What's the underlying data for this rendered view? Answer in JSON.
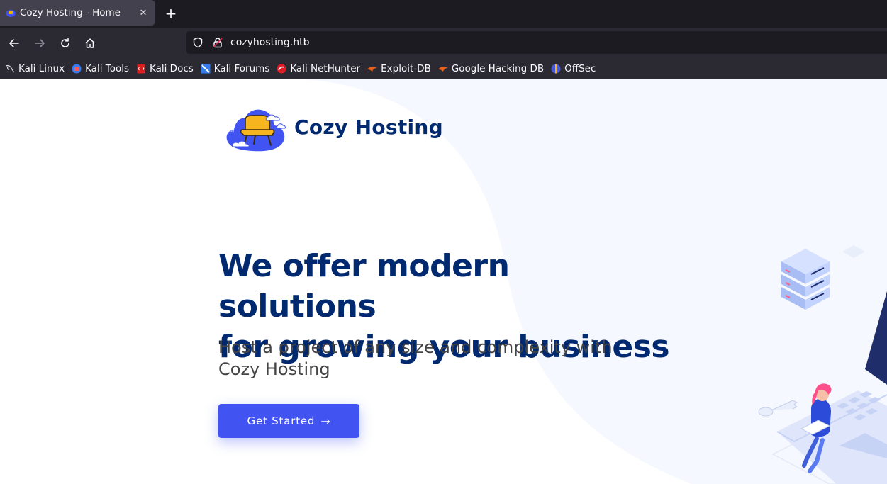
{
  "browser": {
    "tab": {
      "title": "Cozy Hosting - Home"
    },
    "url": "cozyhosting.htb",
    "bookmarks": [
      {
        "label": "Kali Linux",
        "icon": "kali-dragon-icon"
      },
      {
        "label": "Kali Tools",
        "icon": "kali-tools-icon"
      },
      {
        "label": "Kali Docs",
        "icon": "kali-docs-icon"
      },
      {
        "label": "Kali Forums",
        "icon": "kali-forums-icon"
      },
      {
        "label": "Kali NetHunter",
        "icon": "kali-nethunter-icon"
      },
      {
        "label": "Exploit-DB",
        "icon": "exploit-db-icon"
      },
      {
        "label": "Google Hacking DB",
        "icon": "ghdb-icon"
      },
      {
        "label": "OffSec",
        "icon": "offsec-icon"
      }
    ]
  },
  "site": {
    "brand": "Cozy Hosting",
    "hero": {
      "title_line1": "We offer modern solutions",
      "title_line2": "for growing your business",
      "subtitle": "Host a project of any size and complexity with Cozy Hosting",
      "cta_label": "Get Started"
    }
  },
  "colors": {
    "brand_navy": "#012970",
    "accent_blue": "#4154f1",
    "page_bg": "#f5f8fe",
    "browser_dark": "#1c1b22"
  }
}
